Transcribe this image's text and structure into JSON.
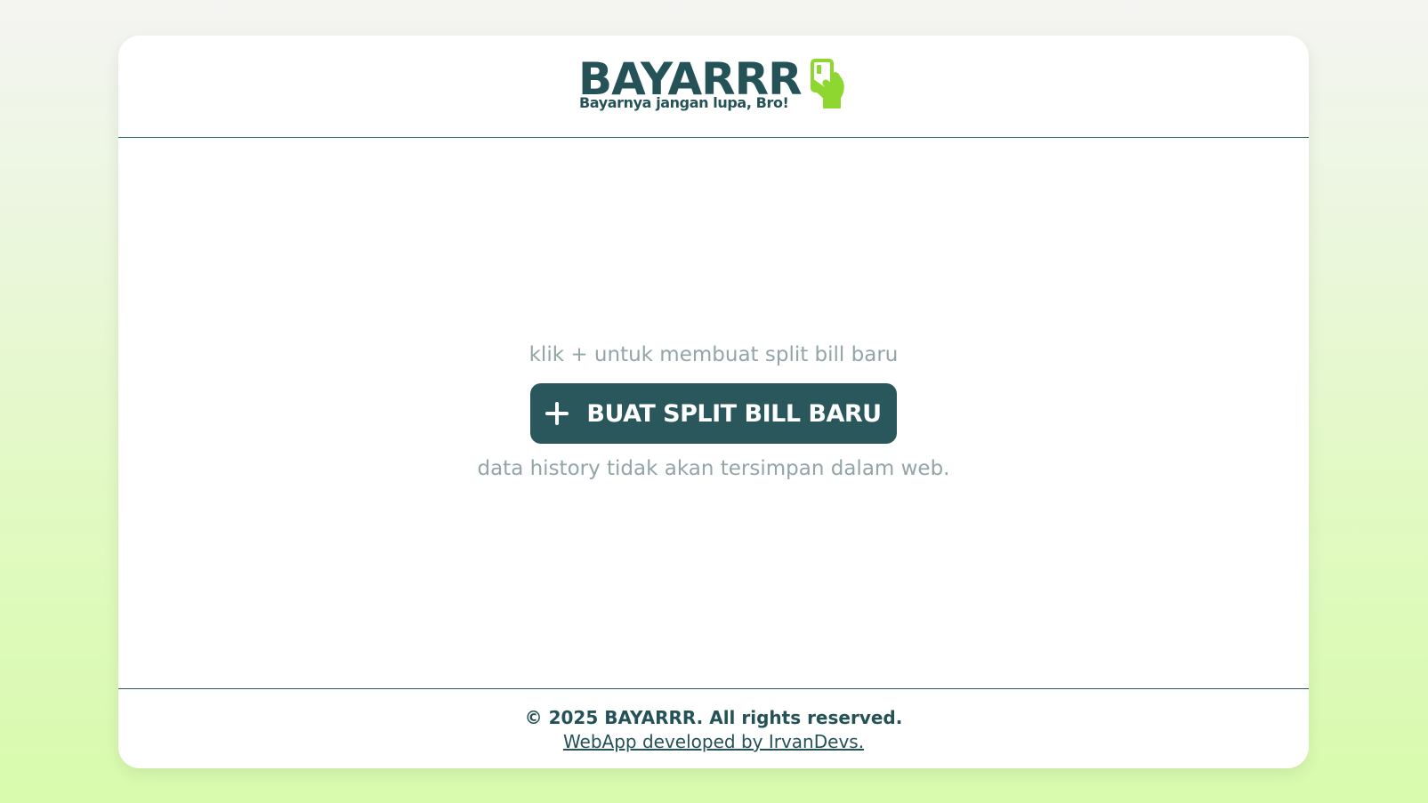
{
  "header": {
    "logo_title": "BAYARRR",
    "logo_tagline": "Bayarnya jangan lupa, Bro!",
    "logo_icon": "hand-holding-card-icon"
  },
  "main": {
    "hint_top": "klik + untuk membuat split bill baru",
    "new_bill_button": "BUAT SPLIT BILL BARU",
    "hint_bottom": "data history tidak akan tersimpan dalam web."
  },
  "footer": {
    "copyright": "© 2025 BAYARRR. All rights reserved.",
    "developer_link": "WebApp developed by IrvanDevs."
  },
  "colors": {
    "primary": "#2a575c",
    "accent": "#8ed630",
    "muted_text": "#93a5a6",
    "background_gradient_end": "#d8fbad"
  }
}
